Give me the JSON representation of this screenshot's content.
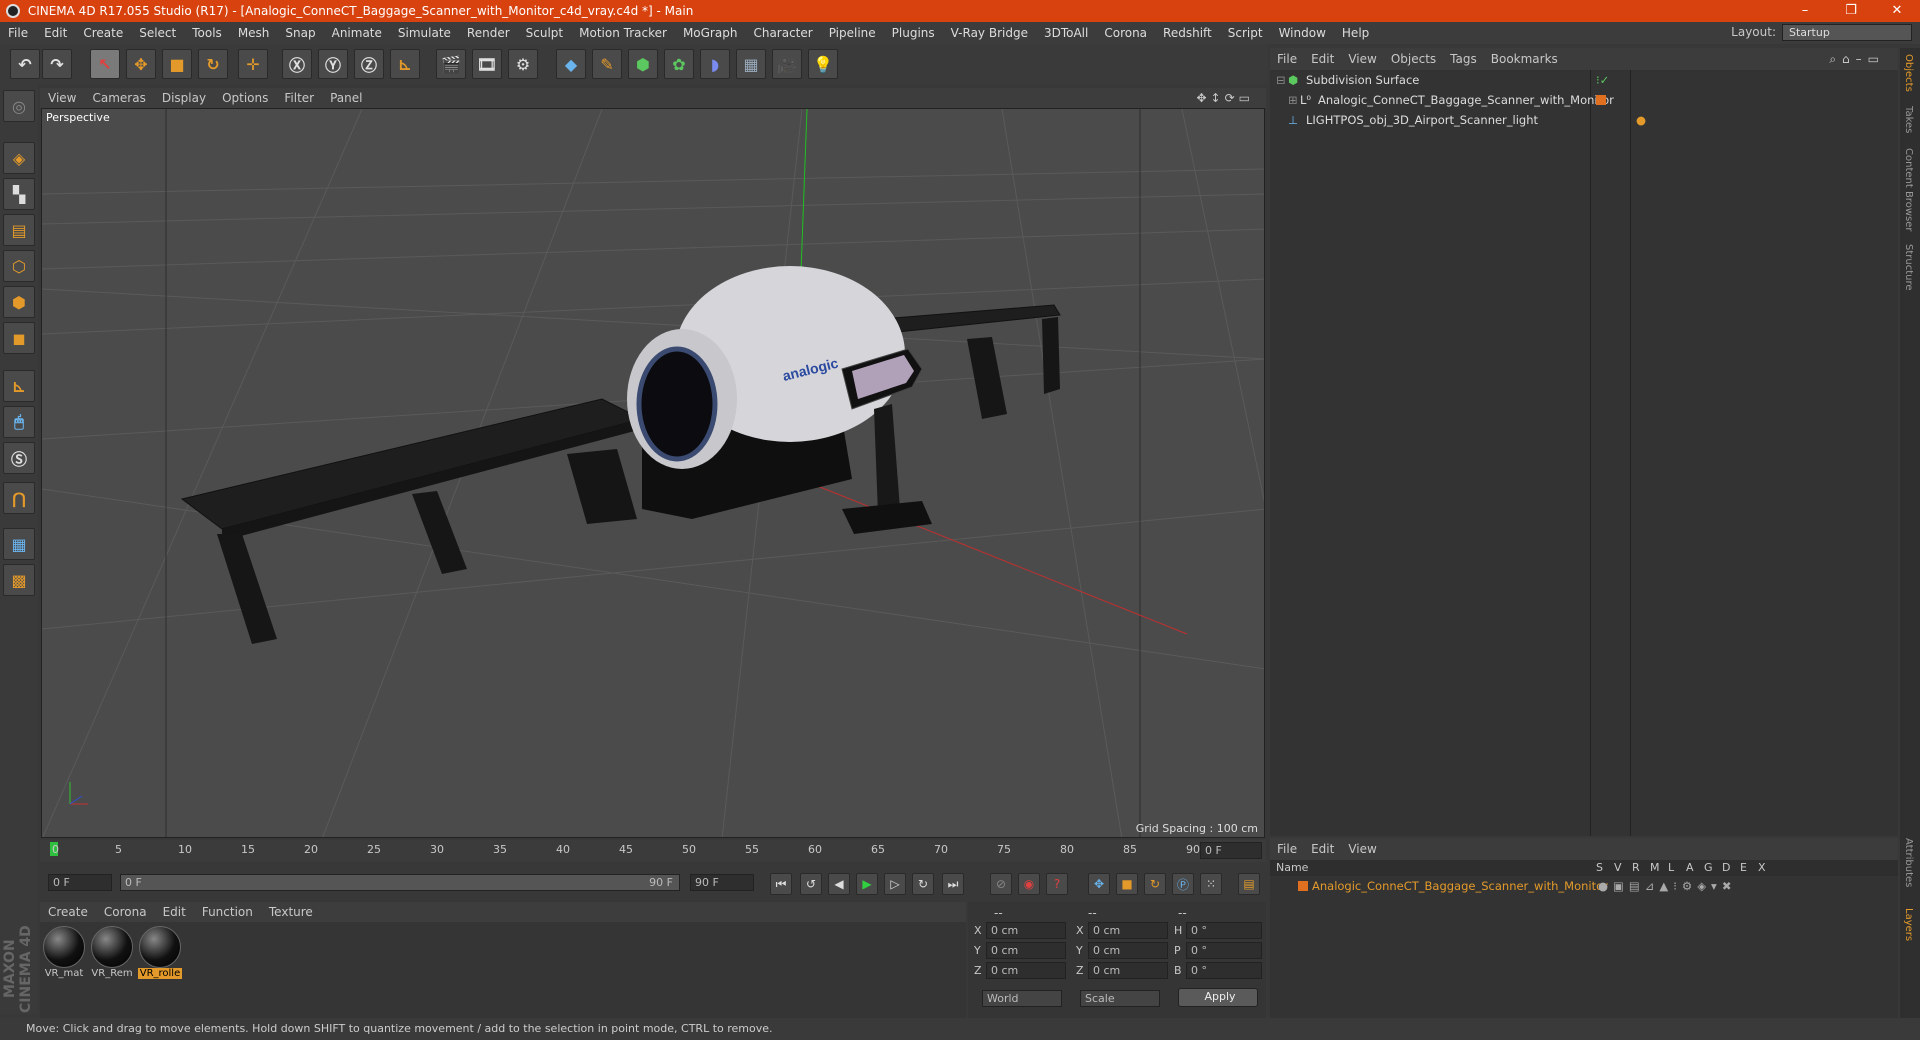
{
  "window": {
    "title": "CINEMA 4D R17.055 Studio (R17) - [Analogic_ConneCT_Baggage_Scanner_with_Monitor_c4d_vray.c4d *] - Main"
  },
  "menu": [
    "File",
    "Edit",
    "Create",
    "Select",
    "Tools",
    "Mesh",
    "Snap",
    "Animate",
    "Simulate",
    "Render",
    "Sculpt",
    "Motion Tracker",
    "MoGraph",
    "Character",
    "Pipeline",
    "Plugins",
    "V-Ray Bridge",
    "3DToAll",
    "Corona",
    "Redshift",
    "Script",
    "Window",
    "Help"
  ],
  "layout": {
    "label": "Layout:",
    "value": "Startup"
  },
  "viewport": {
    "menu": [
      "View",
      "Cameras",
      "Display",
      "Options",
      "Filter",
      "Panel"
    ],
    "label": "Perspective",
    "grid_spacing": "Grid Spacing : 100 cm",
    "brand_text": "analogic"
  },
  "timeline": {
    "ticks": [
      "0",
      "5",
      "10",
      "15",
      "20",
      "25",
      "30",
      "35",
      "40",
      "45",
      "50",
      "55",
      "60",
      "65",
      "70",
      "75",
      "80",
      "85",
      "90"
    ],
    "current_frame": "0 F",
    "start_field": "0 F",
    "range_start": "0 F",
    "range_end": "90 F",
    "end_field": "90 F"
  },
  "materials": {
    "menu": [
      "Create",
      "Corona",
      "Edit",
      "Function",
      "Texture"
    ],
    "items": [
      {
        "label": "VR_mat"
      },
      {
        "label": "VR_Rem"
      },
      {
        "label": "VR_rolle"
      }
    ]
  },
  "coords": {
    "headers": [
      "--",
      "--",
      "--"
    ],
    "rows": [
      {
        "a": "X",
        "av": "0 cm",
        "b": "X",
        "bv": "0 cm",
        "c": "H",
        "cv": "0 °"
      },
      {
        "a": "Y",
        "av": "0 cm",
        "b": "Y",
        "bv": "0 cm",
        "c": "P",
        "cv": "0 °"
      },
      {
        "a": "Z",
        "av": "0 cm",
        "b": "Z",
        "bv": "0 cm",
        "c": "B",
        "cv": "0 °"
      }
    ],
    "world": "World",
    "scale": "Scale",
    "apply": "Apply"
  },
  "objects": {
    "menu": [
      "File",
      "Edit",
      "View",
      "Objects",
      "Tags",
      "Bookmarks"
    ],
    "items": [
      {
        "name": "Subdivision Surface"
      },
      {
        "name": "Analogic_ConneCT_Baggage_Scanner_with_Monitor"
      },
      {
        "name": "LIGHTPOS_obj_3D_Airport_Scanner_light"
      }
    ]
  },
  "layers": {
    "menu": [
      "File",
      "Edit",
      "View"
    ],
    "header_name": "Name",
    "columns": [
      "S",
      "V",
      "R",
      "M",
      "L",
      "A",
      "G",
      "D",
      "E",
      "X"
    ],
    "items": [
      {
        "name": "Analogic_ConneCT_Baggage_Scanner_with_Monitor"
      }
    ]
  },
  "side_tabs": [
    "Objects",
    "Takes",
    "Content Browser",
    "Structure",
    "Attributes",
    "Layers"
  ],
  "status": "Move: Click and drag to move elements. Hold down SHIFT to quantize movement / add to the selection in point mode, CTRL to remove.",
  "brand": "MAXON CINEMA 4D",
  "colors": {
    "titlebar": "#d8420f",
    "accent": "#e39a2a",
    "layer_color": "#e07020"
  }
}
